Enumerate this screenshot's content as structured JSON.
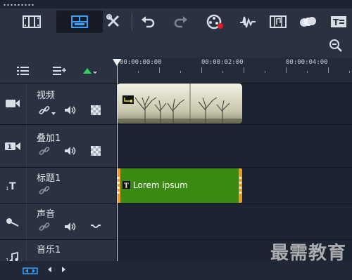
{
  "toolbar": {
    "buttons": [
      {
        "name": "storyboard-view-icon"
      },
      {
        "name": "timeline-view-icon",
        "active": true
      },
      {
        "name": "tools-icon"
      },
      {
        "name": "undo-icon"
      },
      {
        "name": "redo-icon"
      },
      {
        "name": "record-capture-icon"
      },
      {
        "name": "audio-mixer-icon"
      },
      {
        "name": "auto-music-icon"
      },
      {
        "name": "motion-tracking-icon"
      },
      {
        "name": "subtitle-editor-icon"
      }
    ],
    "accent_color": "#3aa0ff"
  },
  "ruler": {
    "labels": [
      "00:00:00:00",
      "00:00:02:00",
      "00:00:04:00"
    ]
  },
  "tracks": [
    {
      "name": "视频",
      "icon": "video-track-icon",
      "controls": [
        "link-icon",
        "volume-icon",
        "checker-icon"
      ]
    },
    {
      "name": "叠加1",
      "icon": "overlay-track-icon",
      "controls": [
        "link-icon",
        "volume-icon",
        "checker-icon"
      ]
    },
    {
      "name": "标题1",
      "icon": "title-track-icon",
      "controls": [
        "link-icon"
      ]
    },
    {
      "name": "声音",
      "icon": "voice-track-icon",
      "controls": [
        "link-icon",
        "volume-icon",
        "wave-icon"
      ]
    },
    {
      "name": "音乐1",
      "icon": "music-track-icon",
      "controls": []
    }
  ],
  "clips": {
    "title_text": "Lorem ipsum",
    "title_color": "#3b8a13",
    "title_edge_color": "#f19a1f"
  },
  "watermark": "最需教育"
}
